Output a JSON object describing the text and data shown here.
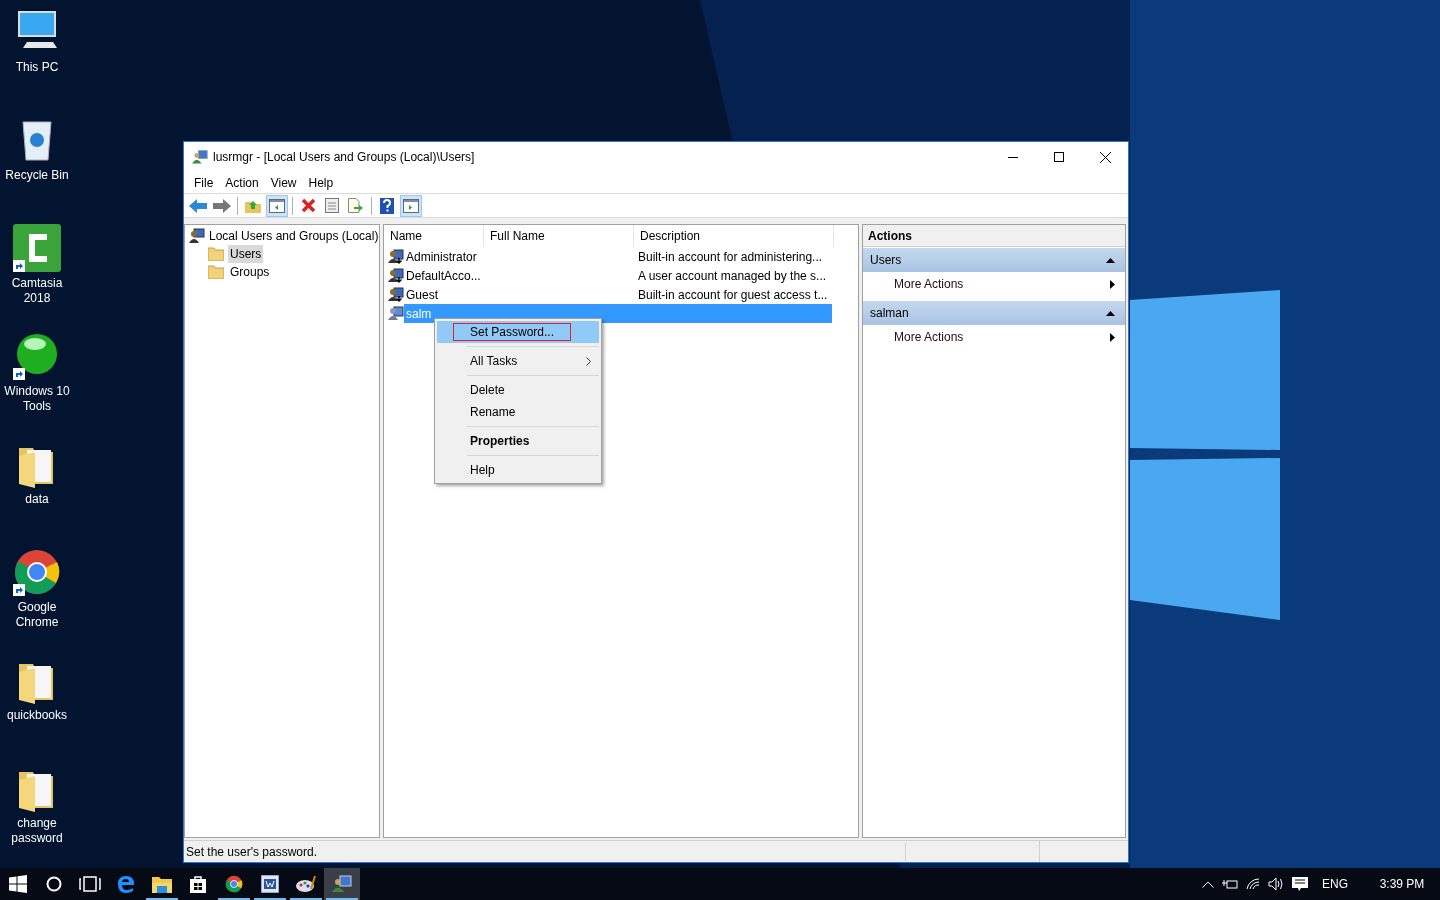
{
  "desktop_icons": [
    {
      "kind": "pc",
      "label": "This PC",
      "shortcut": false
    },
    {
      "kind": "bin",
      "label": "Recycle Bin",
      "shortcut": false
    },
    {
      "kind": "camtasia",
      "label": "Camtasia 2018",
      "shortcut": true
    },
    {
      "kind": "orb",
      "label": "Windows 10 Tools",
      "shortcut": true
    },
    {
      "kind": "folder",
      "label": "data",
      "shortcut": false
    },
    {
      "kind": "chrome",
      "label": "Google Chrome",
      "shortcut": true
    },
    {
      "kind": "folder",
      "label": "quickbooks",
      "shortcut": false
    },
    {
      "kind": "folder",
      "label": "change password",
      "shortcut": false
    }
  ],
  "window": {
    "title": "lusrmgr - [Local Users and Groups (Local)\\Users]",
    "menu": [
      "File",
      "Action",
      "View",
      "Help"
    ],
    "toolbar": [
      {
        "kind": "back",
        "pressed": false
      },
      {
        "kind": "forward",
        "pressed": false
      },
      {
        "kind": "sep"
      },
      {
        "kind": "up",
        "pressed": false
      },
      {
        "kind": "tree",
        "pressed": true
      },
      {
        "kind": "sep"
      },
      {
        "kind": "delete",
        "pressed": false
      },
      {
        "kind": "properties",
        "pressed": false
      },
      {
        "kind": "export",
        "pressed": false
      },
      {
        "kind": "sep"
      },
      {
        "kind": "help",
        "pressed": false
      },
      {
        "kind": "pane",
        "pressed": true
      }
    ],
    "tree": {
      "label": "Local Users and Groups (Local)",
      "children": [
        {
          "label": "Users",
          "selected": true
        },
        {
          "label": "Groups",
          "selected": false
        }
      ]
    },
    "table": {
      "columns": [
        "Name",
        "Full Name",
        "Description"
      ],
      "rows": [
        {
          "name": "Administrator",
          "description": "Built-in account for administering...",
          "selected": false
        },
        {
          "name": "DefaultAcco...",
          "description": "A user account managed by the s...",
          "selected": false
        },
        {
          "name": "Guest",
          "description": "Built-in account for guest access t...",
          "selected": false
        },
        {
          "name": "salm",
          "description": "",
          "selected": true
        }
      ]
    },
    "context_menu": [
      {
        "kind": "item",
        "label": "Set Password...",
        "selected": true,
        "outlined": true,
        "bold": false,
        "submenu": false
      },
      {
        "kind": "separator"
      },
      {
        "kind": "item",
        "label": "All Tasks",
        "selected": false,
        "outlined": false,
        "bold": false,
        "submenu": true
      },
      {
        "kind": "separator"
      },
      {
        "kind": "item",
        "label": "Delete",
        "selected": false,
        "outlined": false,
        "bold": false,
        "submenu": false
      },
      {
        "kind": "item",
        "label": "Rename",
        "selected": false,
        "outlined": false,
        "bold": false,
        "submenu": false
      },
      {
        "kind": "separator"
      },
      {
        "kind": "item",
        "label": "Properties",
        "selected": false,
        "outlined": false,
        "bold": true,
        "submenu": false
      },
      {
        "kind": "separator"
      },
      {
        "kind": "item",
        "label": "Help",
        "selected": false,
        "outlined": false,
        "bold": false,
        "submenu": false
      }
    ],
    "actions": {
      "title": "Actions",
      "sections": [
        {
          "title": "Users",
          "expanded": true,
          "items": [
            "More Actions"
          ]
        },
        {
          "title": "salman",
          "expanded": true,
          "items": [
            "More Actions"
          ]
        }
      ]
    },
    "status_bar": "Set the user's password."
  },
  "taskbar": {
    "apps": [
      {
        "kind": "start",
        "running": false,
        "active": false
      },
      {
        "kind": "search",
        "running": false,
        "active": false
      },
      {
        "kind": "taskview",
        "running": false,
        "active": false
      },
      {
        "kind": "edge",
        "running": false,
        "active": false
      },
      {
        "kind": "explorer",
        "running": true,
        "active": false
      },
      {
        "kind": "store",
        "running": false,
        "active": false
      },
      {
        "kind": "chrome",
        "running": true,
        "active": false
      },
      {
        "kind": "word",
        "running": true,
        "active": false
      },
      {
        "kind": "paint",
        "running": true,
        "active": false
      },
      {
        "kind": "lusrmgr",
        "running": true,
        "active": true
      }
    ],
    "language": "ENG",
    "clock": "3:39 PM"
  }
}
